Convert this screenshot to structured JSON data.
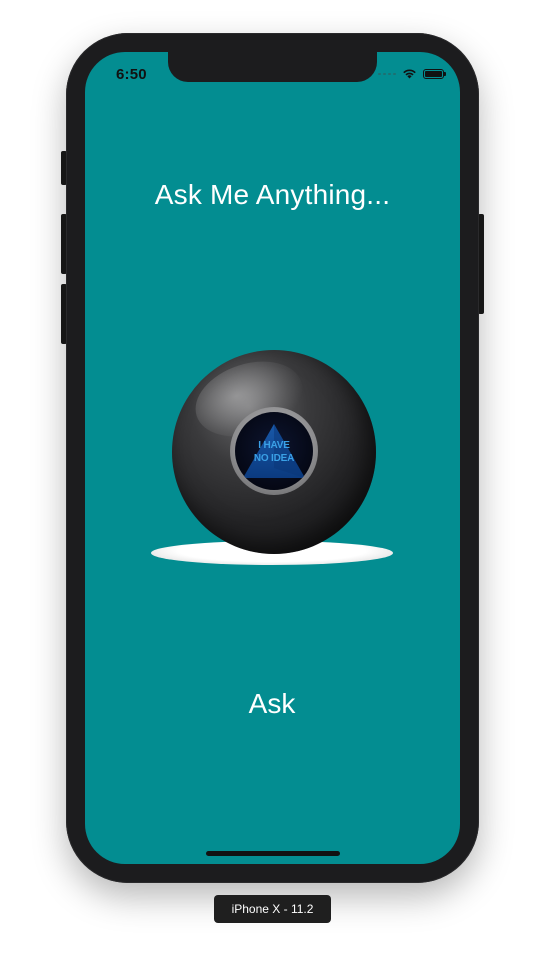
{
  "status_bar": {
    "time": "6:50",
    "icons": [
      "cellular-signal-icon",
      "wifi-icon",
      "battery-icon"
    ]
  },
  "app": {
    "question_label": "Ask Me Anything...",
    "magic_ball": {
      "answer_text": "I HAVE\nNO IDEA",
      "image_name": "magic-8-ball"
    },
    "ask_button_label": "Ask",
    "background_color": "#038d91",
    "text_color": "#ffffff"
  },
  "simulator": {
    "device_label": "iPhone X - 11.2"
  }
}
